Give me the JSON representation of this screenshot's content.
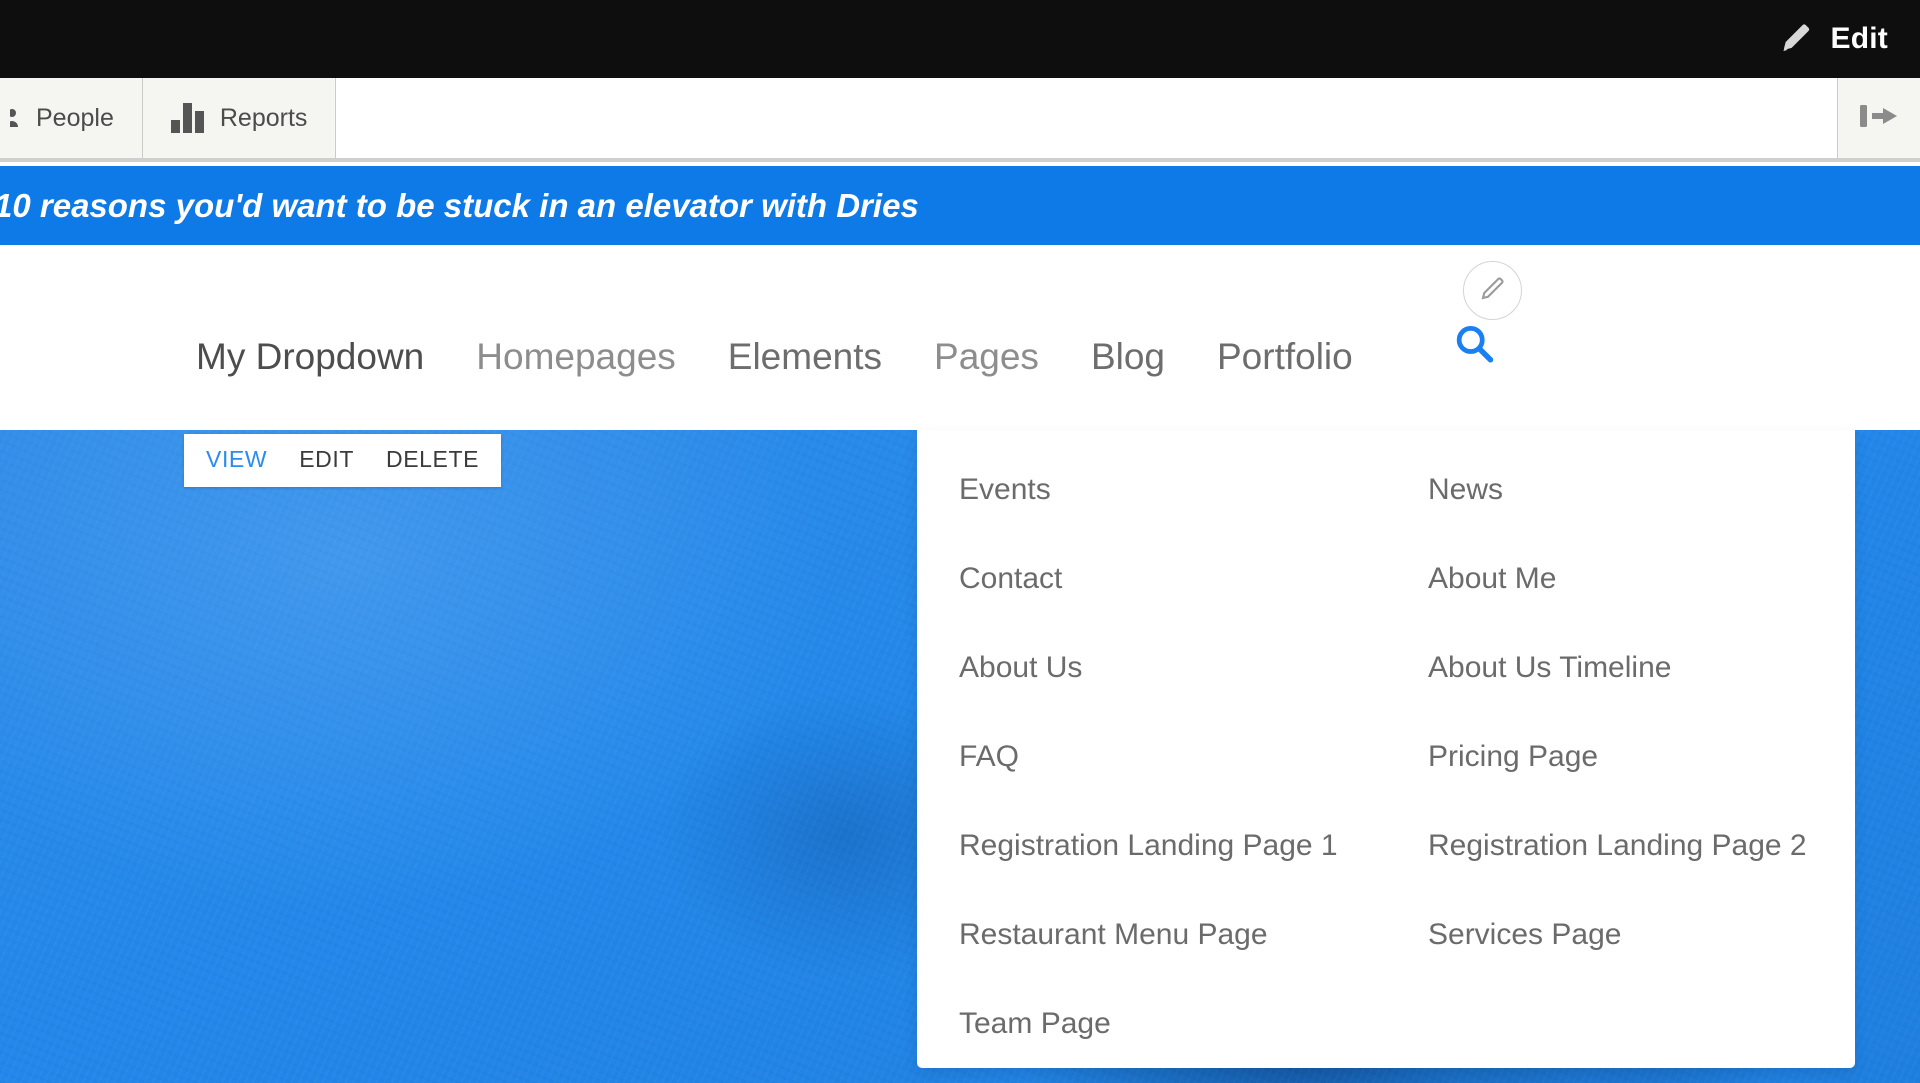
{
  "admin_bar": {
    "edit_label": "Edit",
    "edit_icon": "pencil-icon"
  },
  "toolbar": {
    "tabs": [
      {
        "label": "People",
        "icon": "people-icon"
      },
      {
        "label": "Reports",
        "icon": "bar-chart-icon"
      }
    ],
    "collapse_icon": "collapse-left-icon"
  },
  "banner": {
    "title": "10 reasons you'd want to be stuck in an elevator with Dries"
  },
  "site_nav": {
    "links": [
      {
        "label": "My Dropdown",
        "state": "active"
      },
      {
        "label": "Homepages",
        "state": "normal"
      },
      {
        "label": "Elements",
        "state": "dark"
      },
      {
        "label": "Pages",
        "state": "normal"
      },
      {
        "label": "Blog",
        "state": "dark"
      },
      {
        "label": "Portfolio",
        "state": "dark"
      }
    ],
    "search_icon": "search-icon",
    "edit_circle_icon": "pencil-circle-icon"
  },
  "contextual": {
    "links": [
      {
        "label": "VIEW",
        "style": "primary"
      },
      {
        "label": "EDIT",
        "style": "normal"
      },
      {
        "label": "DELETE",
        "style": "normal"
      }
    ]
  },
  "mega_menu": {
    "left_column": [
      "Events",
      "Contact",
      "About Us",
      "FAQ",
      "Registration Landing Page 1",
      "Restaurant Menu Page",
      "Team Page"
    ],
    "right_column": [
      "News",
      "About Me",
      "About Us Timeline",
      "Pricing Page",
      "Registration Landing Page 2",
      "Services Page"
    ]
  },
  "colors": {
    "accent_blue": "#0d7ae8",
    "link_blue": "#2a8cf0",
    "admin_black": "#0e0e0e",
    "toolbar_gray": "#f5f5f2",
    "text_gray": "#6b6b6b",
    "hero_blue": "#2388ea"
  }
}
